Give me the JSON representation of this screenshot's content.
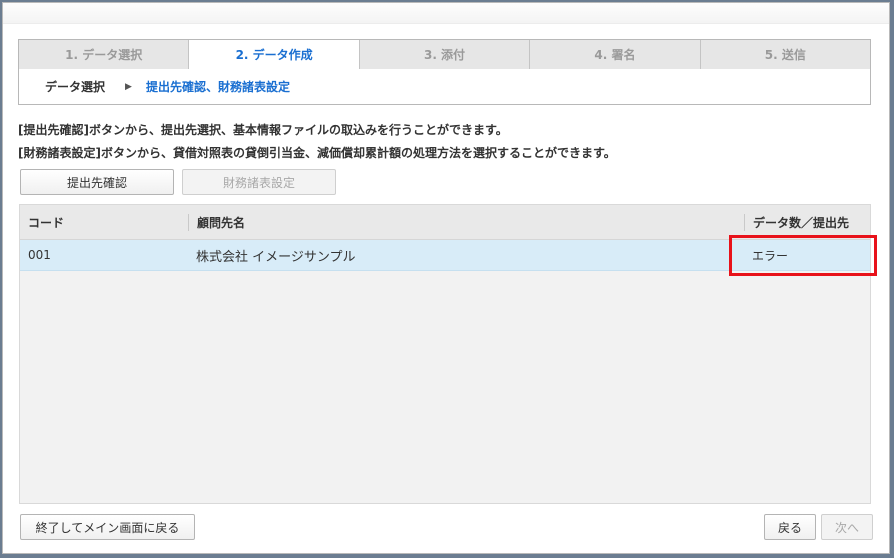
{
  "tabs": [
    {
      "label": "1. データ選択"
    },
    {
      "label": "2. データ作成"
    },
    {
      "label": "3. 添付"
    },
    {
      "label": "4. 署名"
    },
    {
      "label": "5. 送信"
    }
  ],
  "breadcrumb": {
    "step1": "データ選択",
    "arrow": "▶",
    "step2": "提出先確認、財務諸表設定"
  },
  "descriptions": [
    "[提出先確認]ボタンから、提出先選択、基本情報ファイルの取込みを行うことができます。",
    "[財務諸表設定]ボタンから、貸借対照表の貸倒引当金、減価償却累計額の処理方法を選択することができます。"
  ],
  "buttons": {
    "confirm_destination": "提出先確認",
    "financial_settings": "財務諸表設定",
    "exit": "終了してメイン画面に戻る",
    "back": "戻る",
    "next": "次へ"
  },
  "table": {
    "headers": [
      "コード",
      "顧問先名",
      "データ数／提出先"
    ],
    "rows": [
      {
        "code": "001",
        "name": "株式会社 イメージサンプル",
        "status": "エラー"
      }
    ]
  },
  "colors": {
    "active_tab": "#1a6fd1",
    "selected_row": "#d8ecf8",
    "highlight": "#e8121a"
  }
}
